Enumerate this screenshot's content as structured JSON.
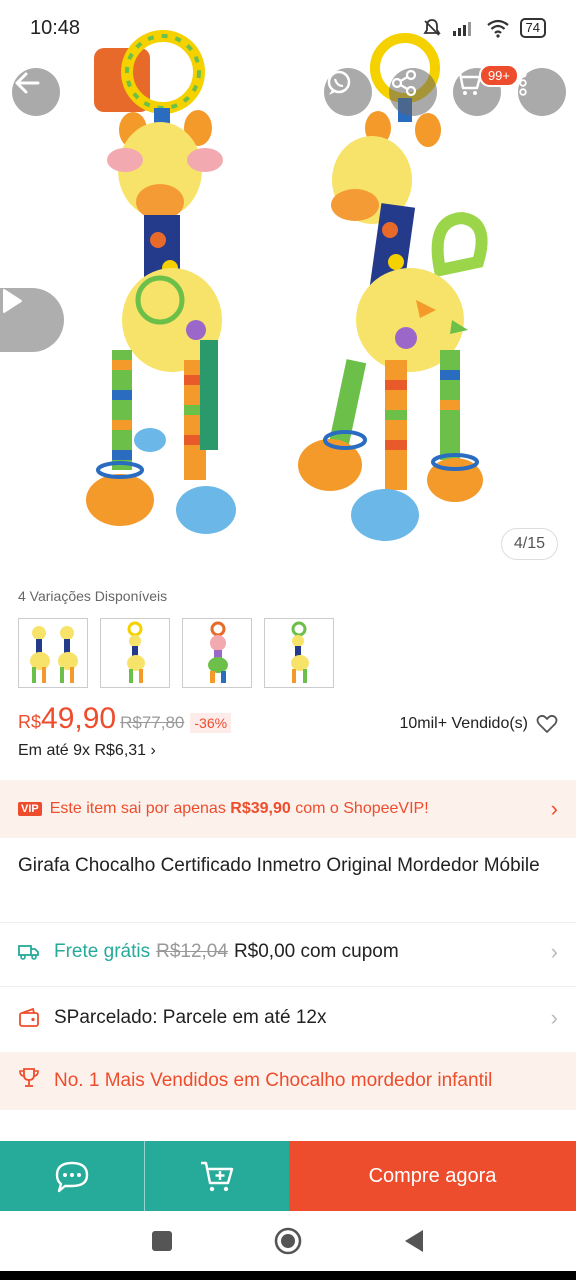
{
  "status_bar": {
    "time": "10:48",
    "battery": "74"
  },
  "top_actions": {
    "cart_badge": "99+"
  },
  "hero": {
    "page_indicator": "4/15"
  },
  "variations": {
    "label": "4 Variações Disponíveis",
    "count": 4
  },
  "price": {
    "currency": "R$",
    "value": "49,90",
    "old_price": "R$77,80",
    "discount": "-36%",
    "sold": "10mil+ Vendido(s)",
    "installments": "Em até 9x R$6,31"
  },
  "vip": {
    "tag": "VIP",
    "text_before": "Este item sai por apenas ",
    "text_price": "R$39,90",
    "text_after": " com o ShopeeVIP!"
  },
  "product": {
    "title": "Girafa Chocalho Certificado Inmetro Original Mordedor Móbile"
  },
  "shipping": {
    "label": "Frete grátis",
    "old_price": "R$12,04",
    "new_text": "R$0,00 com cupom"
  },
  "installment_row": {
    "text": "SParcelado: Parcele em até 12x"
  },
  "bestseller": {
    "text": "No. 1 Mais Vendidos em Chocalho mordedor infantil"
  },
  "bottom_bar": {
    "buy_label": "Compre agora"
  },
  "colors": {
    "primary": "#ee4d2d",
    "teal": "#26aa99"
  }
}
